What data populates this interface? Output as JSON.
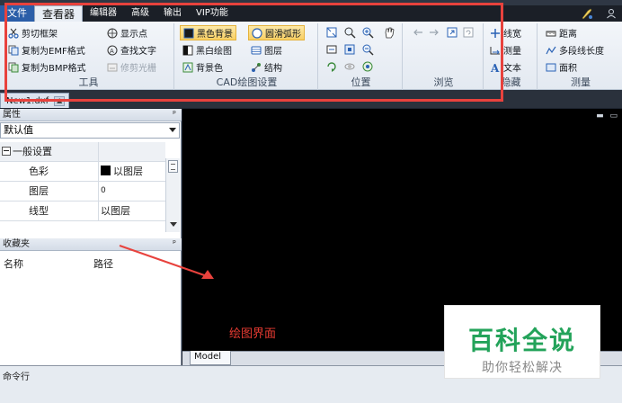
{
  "menu": {
    "file": "文件",
    "viewer": "查看器",
    "editor": "编辑器",
    "advanced": "高级",
    "output": "输出",
    "vip": "VIP功能"
  },
  "ribbon": {
    "tools": {
      "title": "工具",
      "clip_frame": "剪切框架",
      "show_point": "显示点",
      "copy_emf": "复制为EMF格式",
      "find_text": "查找文字",
      "copy_bmp": "复制为BMP格式",
      "trim_raster": "修剪光栅"
    },
    "cad_settings": {
      "title": "CAD绘图设置",
      "black_bg": "黑色背景",
      "smooth_arc": "圆滑弧形",
      "bw_drawing": "黑白绘图",
      "layers": "图层",
      "bg_color": "背景色",
      "structure": "结构"
    },
    "position": {
      "title": "位置"
    },
    "browse": {
      "title": "浏览"
    },
    "hidden": {
      "title": "隐藏",
      "line_width": "线宽",
      "measure": "测量",
      "text": "文本"
    },
    "measure": {
      "title": "测量",
      "distance": "距离",
      "polyline_length": "多段线长度",
      "area": "面积"
    }
  },
  "document_tab": {
    "name": "New1.dxf"
  },
  "properties": {
    "header": "属性",
    "dropdown_value": "默认值",
    "group": "一般设置",
    "rows": [
      {
        "key": "色彩",
        "value": "以图层"
      },
      {
        "key": "图层",
        "value": "0"
      },
      {
        "key": "线型",
        "value": "以图层"
      }
    ]
  },
  "favorites": {
    "header": "收藏夹",
    "col_name": "名称",
    "col_path": "路径"
  },
  "canvas": {
    "annotation_label": "绘图界面",
    "model_tab": "Model"
  },
  "watermark": {
    "title": "百科全说",
    "subtitle": "助你轻松解决"
  },
  "command_line": {
    "label": "命令行"
  },
  "colors": {
    "annotation_red": "#e8423d",
    "canvas_bg": "#000000",
    "watermark_green": "#23a35a"
  }
}
